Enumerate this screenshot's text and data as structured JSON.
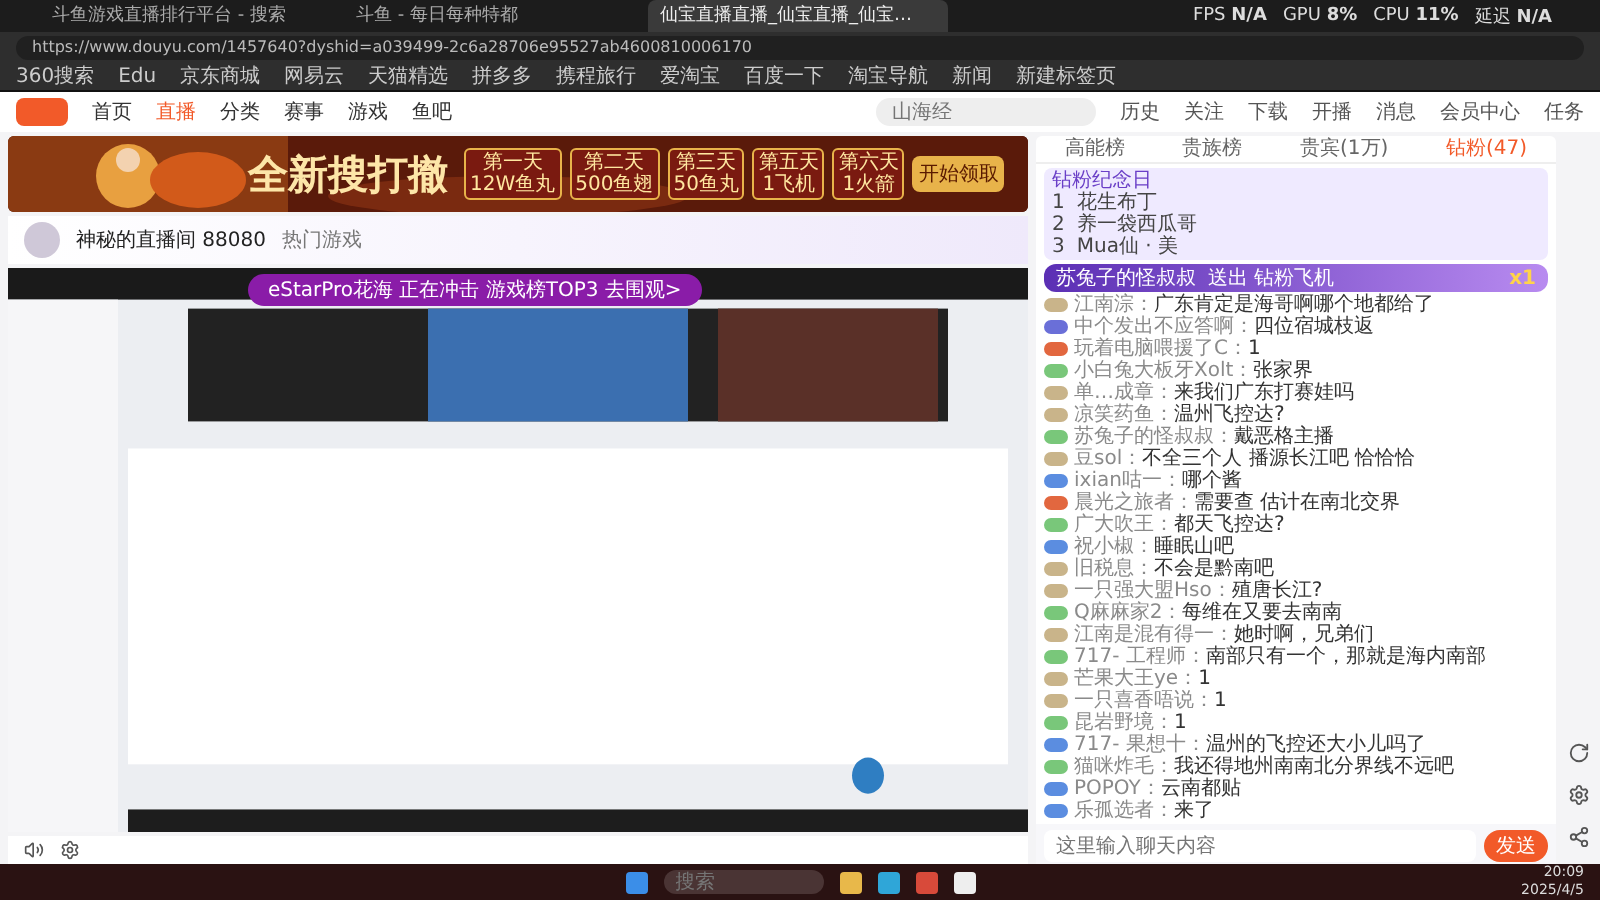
{
  "browser": {
    "tabs": [
      {
        "title": "斗鱼游戏直播排行平台 - 搜索",
        "selected": false
      },
      {
        "title": "斗鱼 - 每日每种特都",
        "selected": false
      },
      {
        "title": "仙宝直播直播_仙宝直播_仙宝…",
        "selected": true
      }
    ],
    "url": "https://www.douyu.com/1457640?dyshid=a039499-2c6a28706e95527ab4600810006170",
    "bookmarks": [
      "360搜索",
      "Edu",
      "京东商城",
      "网易云",
      "天猫精选",
      "拼多多",
      "携程旅行",
      "爱淘宝",
      "百度一下",
      "淘宝导航",
      "新闻",
      "新建标签页"
    ],
    "perf": [
      {
        "label": "FPS",
        "value": "N/A"
      },
      {
        "label": "GPU",
        "value": "8%"
      },
      {
        "label": "CPU",
        "value": "11%"
      },
      {
        "label": "延迟",
        "value": "N/A"
      }
    ]
  },
  "nav": {
    "items": [
      {
        "label": "首页",
        "selected": false
      },
      {
        "label": "直播",
        "selected": true
      },
      {
        "label": "分类",
        "selected": false
      },
      {
        "label": "赛事",
        "selected": false
      },
      {
        "label": "游戏",
        "selected": false
      },
      {
        "label": "鱼吧",
        "selected": false
      }
    ],
    "search": {
      "placeholder": "山海经"
    },
    "actions": [
      "历史",
      "关注",
      "下载",
      "开播",
      "消息",
      "会员中心",
      "任务"
    ]
  },
  "banner": {
    "headline": "全新搜打撤",
    "rewards": [
      {
        "day": "第一天",
        "prize": "12W鱼丸"
      },
      {
        "day": "第二天",
        "prize": "500鱼翅"
      },
      {
        "day": "第三天",
        "prize": "50鱼丸"
      },
      {
        "day": "第五天",
        "prize": "1飞机"
      },
      {
        "day": "第六天",
        "prize": "1火箭"
      }
    ],
    "claim": "开始领取"
  },
  "streamer": {
    "name": "神秘的直播间 88080",
    "category": "热门游戏"
  },
  "video": {
    "promo": "eStarPro花海 正在冲击 游戏榜TOP3 去围观>"
  },
  "chat": {
    "tabs": [
      {
        "label": "高能榜",
        "selected": false
      },
      {
        "label": "贵族榜",
        "selected": false
      },
      {
        "label": "贵宾(1万)",
        "selected": false
      },
      {
        "label": "钻粉(47)",
        "selected": true
      }
    ],
    "rank_title": "钻粉纪念日",
    "ranks": [
      {
        "place": "1",
        "name": "花生布丁"
      },
      {
        "place": "2",
        "name": "养一袋西瓜哥"
      },
      {
        "place": "3",
        "name": "Mua仙 · 美"
      }
    ],
    "gift": {
      "user": "苏兔子的怪叔叔",
      "text": "送出 钻粉飞机",
      "count": "x1"
    },
    "messages": [
      {
        "user": "江南淙：",
        "text": "广东肯定是海哥啊哪个地都给了",
        "color": "#c9b48a"
      },
      {
        "user": "中个发出不应答啊：",
        "text": "四位宿城枝返",
        "color": "#6a6fd8"
      },
      {
        "user": "玩着电脑喂援了C：",
        "text": "1",
        "color": "#e2673f"
      },
      {
        "user": "小白兔大板牙Xolt：",
        "text": "张家界",
        "color": "#79c77a"
      },
      {
        "user": "单…成章：",
        "text": "来我们广东打赛娃吗",
        "color": "#c9b48a"
      },
      {
        "user": "凉笑药鱼：",
        "text": "温州飞控达?",
        "color": "#c9b48a"
      },
      {
        "user": "苏兔子的怪叔叔：",
        "text": "戴恶格主播",
        "color": "#79c77a"
      },
      {
        "user": "豆sol：",
        "text": "不全三个人 播源长江吧 恰恰恰",
        "color": "#c9b48a"
      },
      {
        "user": "ixian咕一：",
        "text": "哪个酱",
        "color": "#5b8de0"
      },
      {
        "user": "晨光之旅者：",
        "text": "需要查 估计在南北交界",
        "color": "#e2673f"
      },
      {
        "user": "广大吹王：",
        "text": "都天飞控达?",
        "color": "#79c77a"
      },
      {
        "user": "祝小椒：",
        "text": "睡眠山吧",
        "color": "#5b8de0"
      },
      {
        "user": "旧税息：",
        "text": "不会是黔南吧",
        "color": "#c9b48a"
      },
      {
        "user": "一只强大盟Hso：",
        "text": "殖唐长江?",
        "color": "#c9b48a"
      },
      {
        "user": "Q麻麻家2：",
        "text": "每维在又要去南南",
        "color": "#79c77a"
      },
      {
        "user": "江南是混有得一：",
        "text": "她时啊，兄弟们",
        "color": "#c9b48a"
      },
      {
        "user": "717- 工程师：",
        "text": "南部只有一个，那就是海内南部",
        "color": "#79c77a"
      },
      {
        "user": "芒果大王ye：",
        "text": "1",
        "color": "#c9b48a"
      },
      {
        "user": "一只喜香唔说：",
        "text": "1",
        "color": "#c9b48a"
      },
      {
        "user": "昆岩野境：",
        "text": "1",
        "color": "#79c77a"
      },
      {
        "user": "717- 果想十：",
        "text": "温州的飞控还大小儿吗了",
        "color": "#5b8de0"
      },
      {
        "user": "猫咪炸毛：",
        "text": "我还得地州南南北分界线不远吧",
        "color": "#79c77a"
      },
      {
        "user": "POPOY：",
        "text": "云南都贴",
        "color": "#5b8de0"
      },
      {
        "user": "乐孤选者：",
        "text": "来了",
        "color": "#5b8de0"
      }
    ],
    "input": {
      "placeholder": "这里输入聊天内容"
    },
    "send": "发送"
  },
  "taskbar": {
    "search": {
      "placeholder": "搜索"
    },
    "time": "20:09",
    "date": "2025/4/5"
  }
}
